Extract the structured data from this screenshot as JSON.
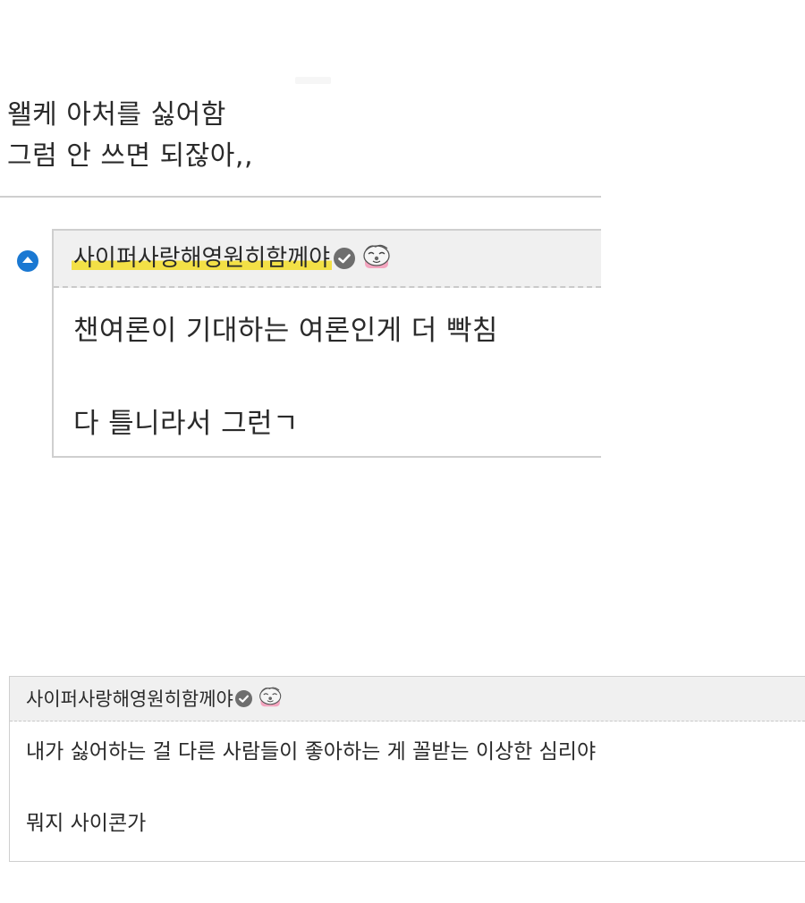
{
  "post": {
    "lines": [
      "왤케 아처를 싫어함",
      "그럼 안 쓰면 되잖아,,"
    ]
  },
  "comment_main": {
    "author": "사이퍼사랑해영원히함께야",
    "lines": [
      "챈여론이 기대하는 여론인게 더 빡침",
      "다 틀니라서 그런ㄱ"
    ]
  },
  "comment_reply": {
    "author": "사이퍼사랑해영원히함께야",
    "lines": [
      "내가 싫어하는 걸 다른 사람들이 좋아하는 게 꼴받는 이상한 심리야",
      "뭐지 사이콘가"
    ]
  },
  "icons": {
    "toggle": "collapse-arrow-icon",
    "badge": "verified-check-icon",
    "mascot": "mascot-emoticon-icon"
  },
  "colors": {
    "accent": "#1a78d2",
    "highlight": "#f3e046",
    "header_bg": "#f0f0f0",
    "badge": "#6e6e6e"
  }
}
